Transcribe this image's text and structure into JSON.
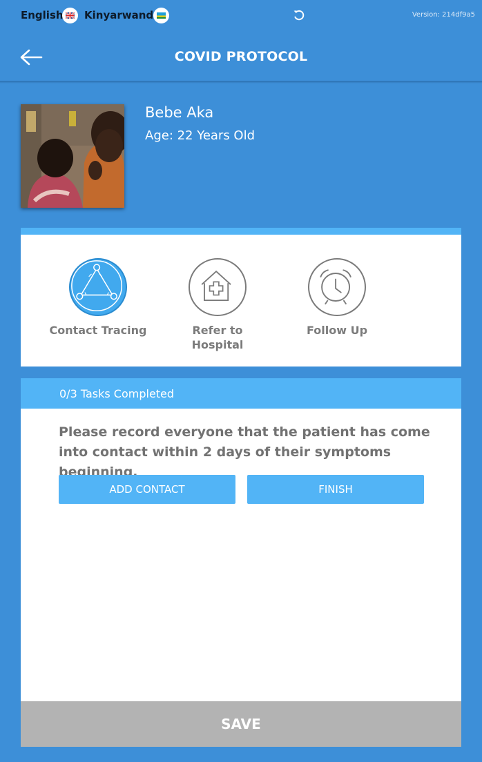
{
  "status_bar": {
    "languages": [
      {
        "label": "English",
        "flag": "uk-flag-icon"
      },
      {
        "label": "Kinyarwanda",
        "flag": "rwanda-flag-icon"
      }
    ],
    "refresh_icon": "refresh-icon",
    "version": "Version: 214df9a5"
  },
  "header": {
    "back_icon": "arrow-left-icon",
    "title": "COVID PROTOCOL"
  },
  "patient": {
    "name": "Bebe Aka",
    "age": "Age: 22 Years Old"
  },
  "protocol_steps": [
    {
      "label": "Contact Tracing",
      "icon": "triangle-network-icon",
      "active": true
    },
    {
      "label": "Refer to Hospital",
      "icon": "hospital-icon",
      "active": false
    },
    {
      "label": "Follow Up",
      "icon": "alarm-clock-icon",
      "active": false
    }
  ],
  "tasks": {
    "progress": "0/3 Tasks Completed",
    "instruction": "Please record everyone that the patient has come into contact within 2 days of their symptoms beginning.",
    "add_contact_label": "ADD CONTACT",
    "finish_label": "FINISH"
  },
  "save_label": "SAVE",
  "colors": {
    "background": "#3d8fd8",
    "accent": "#52b4f6",
    "active_step": "#41a9ee",
    "save_disabled": "#b3b3b3"
  }
}
